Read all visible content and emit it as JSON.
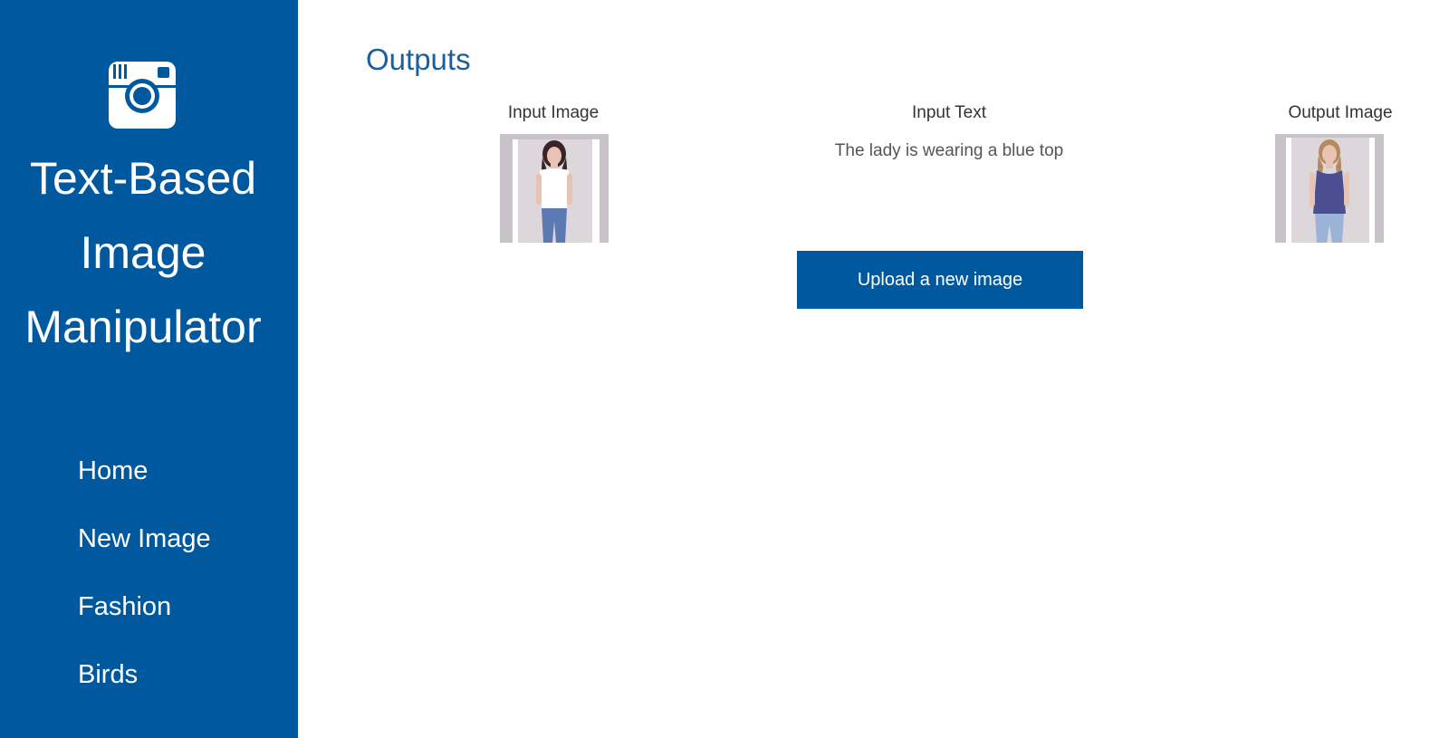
{
  "sidebar": {
    "logo_icon": "camera-icon",
    "title_lines": [
      "Text-Based",
      "Image",
      "Manipulator"
    ],
    "nav": [
      "Home",
      "New Image",
      "Fashion",
      "Birds"
    ]
  },
  "main": {
    "title": "Outputs",
    "input_image_label": "Input Image",
    "input_text_label": "Input Text",
    "output_image_label": "Output Image",
    "input_text_value": "The lady is wearing a blue top",
    "upload_button_label": "Upload a new image",
    "input_image": {
      "top_color": "#ffffff",
      "pants_color": "#5b79b3"
    },
    "output_image": {
      "top_color": "#4c4e92",
      "pants_color": "#9bb3d6"
    }
  },
  "colors": {
    "sidebar_bg": "#00599f",
    "accent": "#00599f",
    "title_color": "#1b5f9e"
  }
}
